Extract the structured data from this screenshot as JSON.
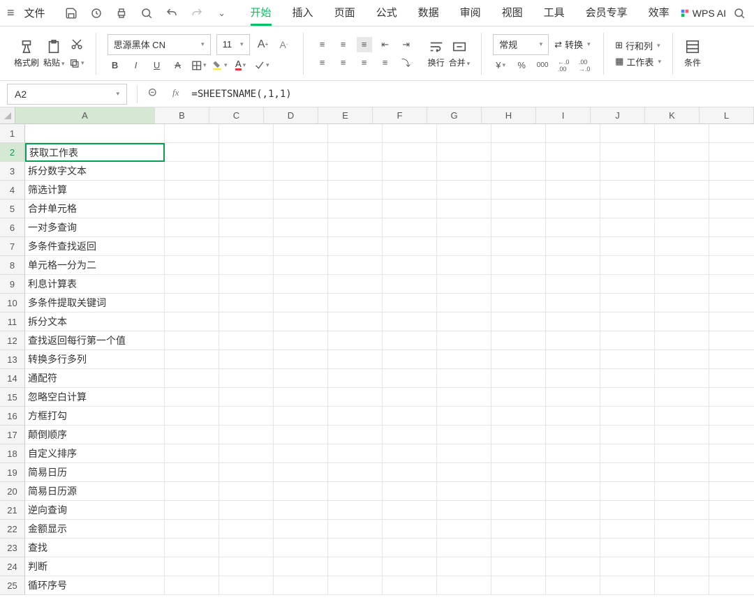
{
  "menu": {
    "file_label": "文件",
    "tabs": [
      "开始",
      "插入",
      "页面",
      "公式",
      "数据",
      "审阅",
      "视图",
      "工具",
      "会员专享",
      "效率"
    ],
    "active_tab": "开始",
    "wps_ai": "WPS AI"
  },
  "ribbon": {
    "format_painter": "格式刷",
    "paste": "粘贴",
    "font_name": "思源黑体 CN",
    "font_size": "11",
    "wrap": "换行",
    "merge": "合并",
    "number_format": "常规",
    "convert": "转换",
    "row_col": "行和列",
    "worksheet": "工作表",
    "conditional": "条件"
  },
  "formula_bar": {
    "cell_ref": "A2",
    "formula": "=SHEETSNAME(,1,1)"
  },
  "columns": [
    "A",
    "B",
    "C",
    "D",
    "E",
    "F",
    "G",
    "H",
    "I",
    "J",
    "K",
    "L"
  ],
  "col_widths": {
    "A": 200,
    "other": 78
  },
  "active_cell": {
    "row": 2,
    "col": "A"
  },
  "rows": [
    {
      "n": 1,
      "A": ""
    },
    {
      "n": 2,
      "A": "获取工作表"
    },
    {
      "n": 3,
      "A": "拆分数字文本"
    },
    {
      "n": 4,
      "A": "筛选计算"
    },
    {
      "n": 5,
      "A": "合并单元格"
    },
    {
      "n": 6,
      "A": "一对多查询"
    },
    {
      "n": 7,
      "A": "多条件查找返回"
    },
    {
      "n": 8,
      "A": "单元格一分为二"
    },
    {
      "n": 9,
      "A": "利息计算表"
    },
    {
      "n": 10,
      "A": "多条件提取关键词"
    },
    {
      "n": 11,
      "A": "拆分文本"
    },
    {
      "n": 12,
      "A": "查找返回每行第一个值"
    },
    {
      "n": 13,
      "A": "转换多行多列"
    },
    {
      "n": 14,
      "A": "通配符"
    },
    {
      "n": 15,
      "A": "忽略空白计算"
    },
    {
      "n": 16,
      "A": "方框打勾"
    },
    {
      "n": 17,
      "A": "颠倒顺序"
    },
    {
      "n": 18,
      "A": "自定义排序"
    },
    {
      "n": 19,
      "A": "简易日历"
    },
    {
      "n": 20,
      "A": "简易日历源"
    },
    {
      "n": 21,
      "A": "逆向查询"
    },
    {
      "n": 22,
      "A": "金额显示"
    },
    {
      "n": 23,
      "A": "查找"
    },
    {
      "n": 24,
      "A": "判断"
    },
    {
      "n": 25,
      "A": "循环序号"
    }
  ]
}
